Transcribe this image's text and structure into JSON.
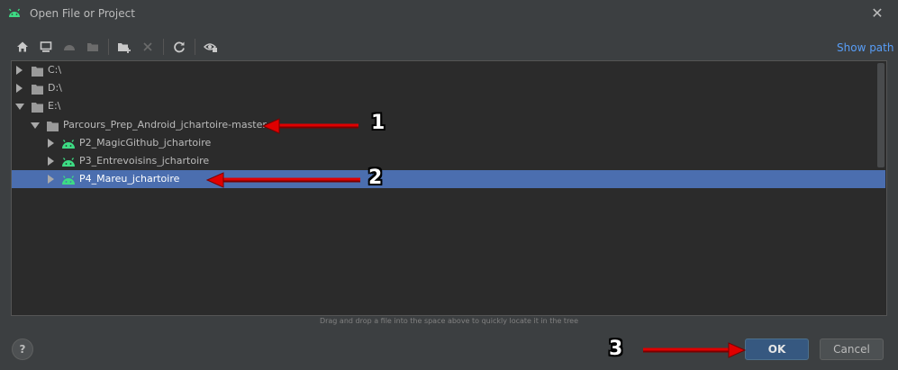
{
  "window": {
    "title": "Open File or Project",
    "close_glyph": "✕"
  },
  "toolbar": {
    "buttons": [
      {
        "name": "home-icon",
        "enabled": true
      },
      {
        "name": "desktop-icon",
        "enabled": true
      },
      {
        "name": "android-project-icon",
        "enabled": false
      },
      {
        "name": "module-folder-icon",
        "enabled": false
      },
      {
        "name": "new-folder-icon",
        "enabled": true
      },
      {
        "name": "delete-icon",
        "enabled": false
      },
      {
        "name": "refresh-icon",
        "enabled": true
      },
      {
        "name": "show-hidden-files-icon",
        "enabled": true
      }
    ],
    "show_path_label": "Show path"
  },
  "tree": {
    "rows": [
      {
        "label": "C:\\",
        "expanded": false,
        "icon": "drive-icon"
      },
      {
        "label": "D:\\",
        "expanded": false,
        "icon": "drive-icon"
      },
      {
        "label": "E:\\",
        "expanded": true,
        "icon": "drive-icon"
      },
      {
        "label": "Parcours_Prep_Android_jchartoire-master",
        "expanded": true,
        "icon": "folder-icon"
      },
      {
        "label": "P2_MagicGithub_jchartoire",
        "expanded": false,
        "icon": "android-icon"
      },
      {
        "label": "P3_Entrevoisins_jchartoire",
        "expanded": false,
        "icon": "android-icon"
      },
      {
        "label": "P4_Mareu_jchartoire",
        "expanded": false,
        "icon": "android-icon",
        "selected": true
      }
    ]
  },
  "hint": "Drag and drop a file into the space above to quickly locate it in the tree",
  "buttons": {
    "help": "?",
    "ok": "OK",
    "cancel": "Cancel"
  },
  "annotations": {
    "one": "1",
    "two": "2",
    "three": "3"
  },
  "colors": {
    "background": "#3c3f41",
    "tree_background": "#2b2b2b",
    "selection": "#4b6eaf",
    "android_green": "#3ddc84",
    "link": "#589df6",
    "annotation_red": "#e00000"
  }
}
